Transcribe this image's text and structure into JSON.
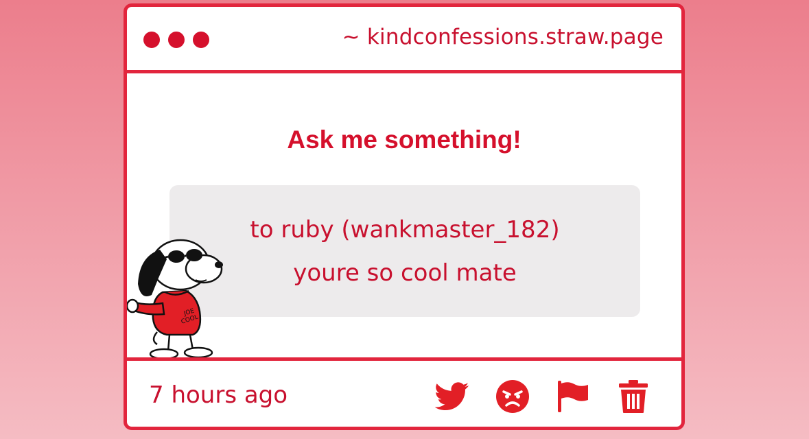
{
  "colors": {
    "accent": "#e2253d",
    "text": "#c8102e",
    "bubble_bg": "#edebec"
  },
  "window": {
    "dots": [
      "red-dot",
      "red-dot",
      "red-dot"
    ],
    "url": "~ kindconfessions.straw.page"
  },
  "main": {
    "heading": "Ask me something!",
    "message": {
      "line1": "to ruby (wankmaster_182)",
      "line2": "youre so cool mate"
    },
    "sticker": {
      "icon": "snoopy-joe-cool-sticker",
      "sweater_text": "JOE COOL"
    }
  },
  "footer": {
    "timestamp": "7 hours ago",
    "actions": [
      {
        "name": "share-twitter",
        "icon": "twitter-bird-icon"
      },
      {
        "name": "react-angry",
        "icon": "angry-face-icon"
      },
      {
        "name": "report",
        "icon": "flag-icon"
      },
      {
        "name": "delete",
        "icon": "trash-icon"
      }
    ]
  }
}
